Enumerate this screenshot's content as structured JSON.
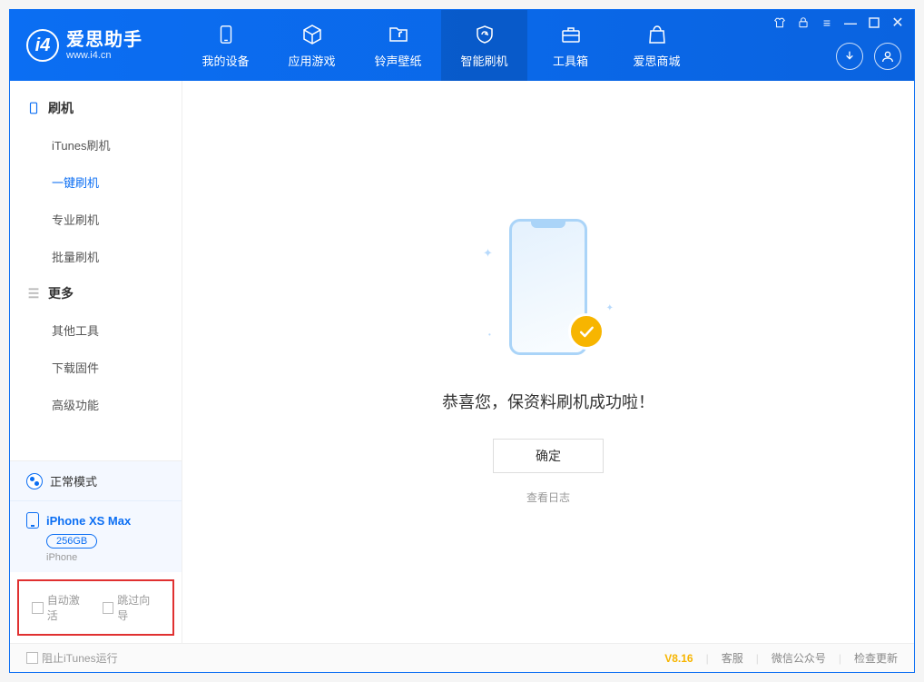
{
  "app": {
    "name": "爱思助手",
    "url": "www.i4.cn"
  },
  "nav": {
    "tabs": [
      {
        "label": "我的设备"
      },
      {
        "label": "应用游戏"
      },
      {
        "label": "铃声壁纸"
      },
      {
        "label": "智能刷机"
      },
      {
        "label": "工具箱"
      },
      {
        "label": "爱思商城"
      }
    ],
    "active_index": 3
  },
  "sidebar": {
    "group1": {
      "title": "刷机",
      "items": [
        "iTunes刷机",
        "一键刷机",
        "专业刷机",
        "批量刷机"
      ],
      "active_index": 1
    },
    "group2": {
      "title": "更多",
      "items": [
        "其他工具",
        "下载固件",
        "高级功能"
      ]
    },
    "mode": "正常模式",
    "device": {
      "name": "iPhone XS Max",
      "storage": "256GB",
      "type": "iPhone"
    },
    "checkbox1": "自动激活",
    "checkbox2": "跳过向导"
  },
  "main": {
    "success_message": "恭喜您，保资料刷机成功啦！",
    "ok_button": "确定",
    "view_log": "查看日志"
  },
  "footer": {
    "block_itunes": "阻止iTunes运行",
    "version": "V8.16",
    "links": [
      "客服",
      "微信公众号",
      "检查更新"
    ]
  }
}
